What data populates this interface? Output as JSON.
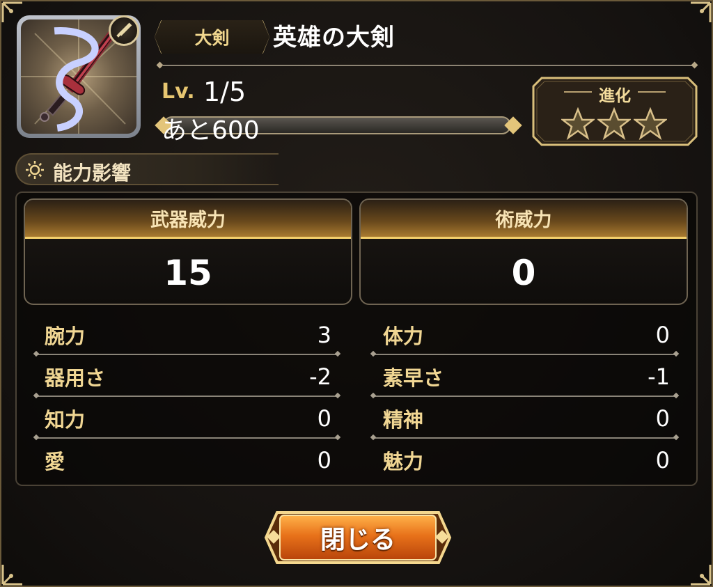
{
  "weapon": {
    "category": "大剣",
    "name": "英雄の大剣",
    "icon": "greatsword-icon",
    "type_icon": "sword-type-icon"
  },
  "level": {
    "label": "Lv.",
    "value": "1/5",
    "exp_text": "あと600",
    "exp_progress": 0
  },
  "evolution": {
    "title": "進化",
    "stars_filled": 0,
    "stars_total": 3
  },
  "section": {
    "title": "能力影響",
    "icon": "sun-icon"
  },
  "power": {
    "weapon_label": "武器威力",
    "weapon_value": "15",
    "magic_label": "術威力",
    "magic_value": "0"
  },
  "stats": {
    "left": [
      {
        "name": "腕力",
        "value": "3"
      },
      {
        "name": "器用さ",
        "value": "-2"
      },
      {
        "name": "知力",
        "value": "0"
      },
      {
        "name": "愛",
        "value": "0"
      }
    ],
    "right": [
      {
        "name": "体力",
        "value": "0"
      },
      {
        "name": "素早さ",
        "value": "-1"
      },
      {
        "name": "精神",
        "value": "0"
      },
      {
        "name": "魅力",
        "value": "0"
      }
    ]
  },
  "close_button": {
    "label": "閉じる"
  },
  "colors": {
    "gold": "#f0d693",
    "accent_orange": "#e06a12",
    "frame": "#6b5a3a"
  }
}
